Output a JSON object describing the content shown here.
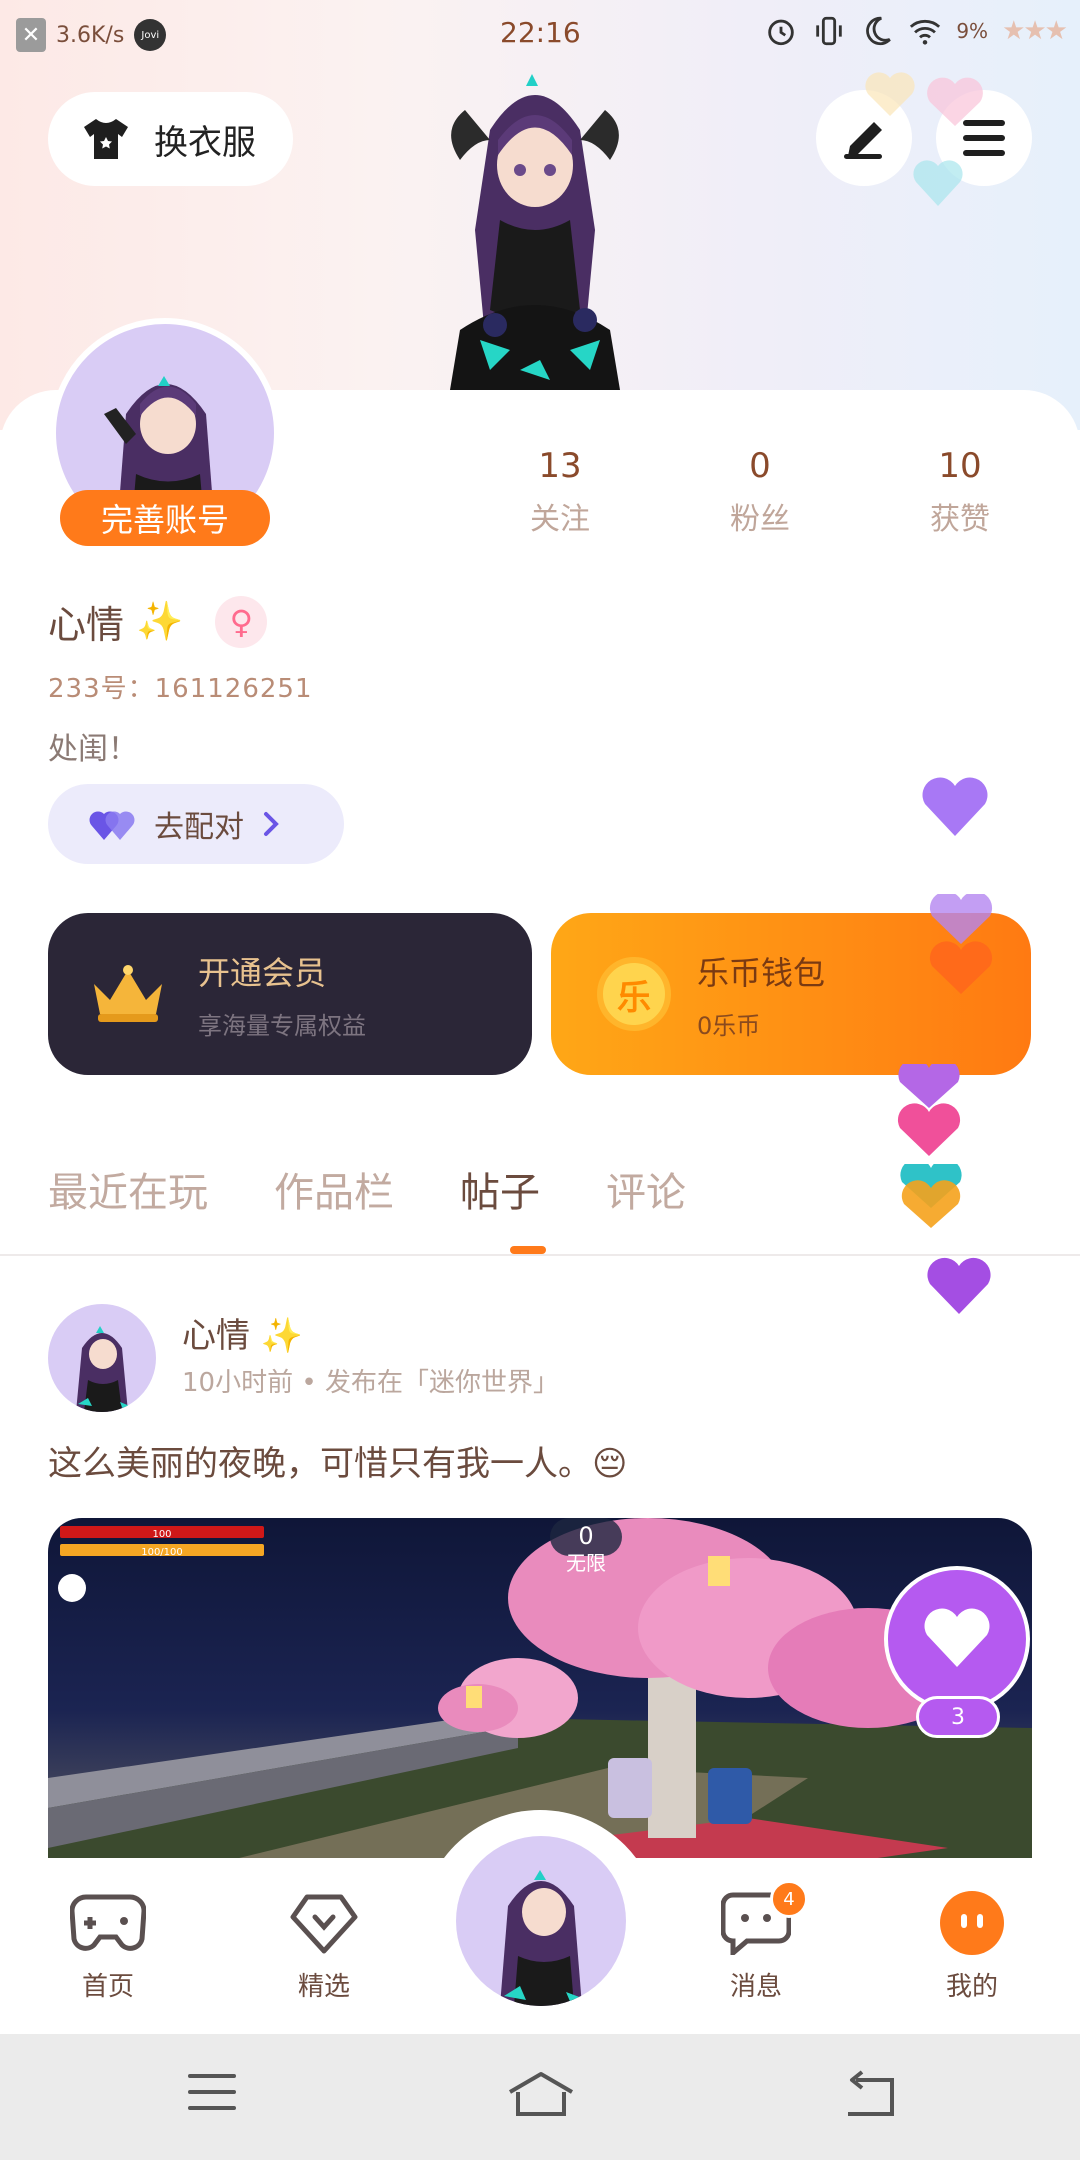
{
  "status_bar": {
    "net_speed": "3.6K/s",
    "assistant": "Jovi",
    "time": "22:16",
    "battery": "9%"
  },
  "header": {
    "outfit_label": "换衣服"
  },
  "profile": {
    "complete_account_label": "完善账号",
    "stats": [
      {
        "value": "13",
        "label": "关注"
      },
      {
        "value": "0",
        "label": "粉丝"
      },
      {
        "value": "10",
        "label": "获赞"
      }
    ],
    "name": "心情",
    "sparkle": "✨",
    "gender_symbol": "♀",
    "uid": "233号：161126251",
    "bio": "处闺！",
    "pair_label": "去配对"
  },
  "cards": {
    "vip_title": "开通会员",
    "vip_subtitle": "享海量专属权益",
    "coin_icon": "乐",
    "coin_title": "乐币钱包",
    "coin_subtitle": "0乐币"
  },
  "tabs": [
    "最近在玩",
    "作品栏",
    "帖子",
    "评论"
  ],
  "active_tab": 2,
  "post": {
    "author": "心情",
    "sparkle": "✨",
    "meta": "10小时前 • 发布在「迷你世界」",
    "text": "这么美丽的夜晚，可惜只有我一人。😔",
    "game_hud": {
      "health": "100",
      "hunger": "100/100",
      "score": "0",
      "mode": "无限"
    },
    "like_count": "3"
  },
  "bottom_nav": {
    "items": [
      "首页",
      "精选",
      "消息",
      "我的"
    ],
    "message_badge": "4"
  },
  "colors": {
    "accent": "#ff7a1a",
    "vip_bg": "#2b2637",
    "pair_bg": "#ecebfb",
    "like": "#b55af0"
  }
}
